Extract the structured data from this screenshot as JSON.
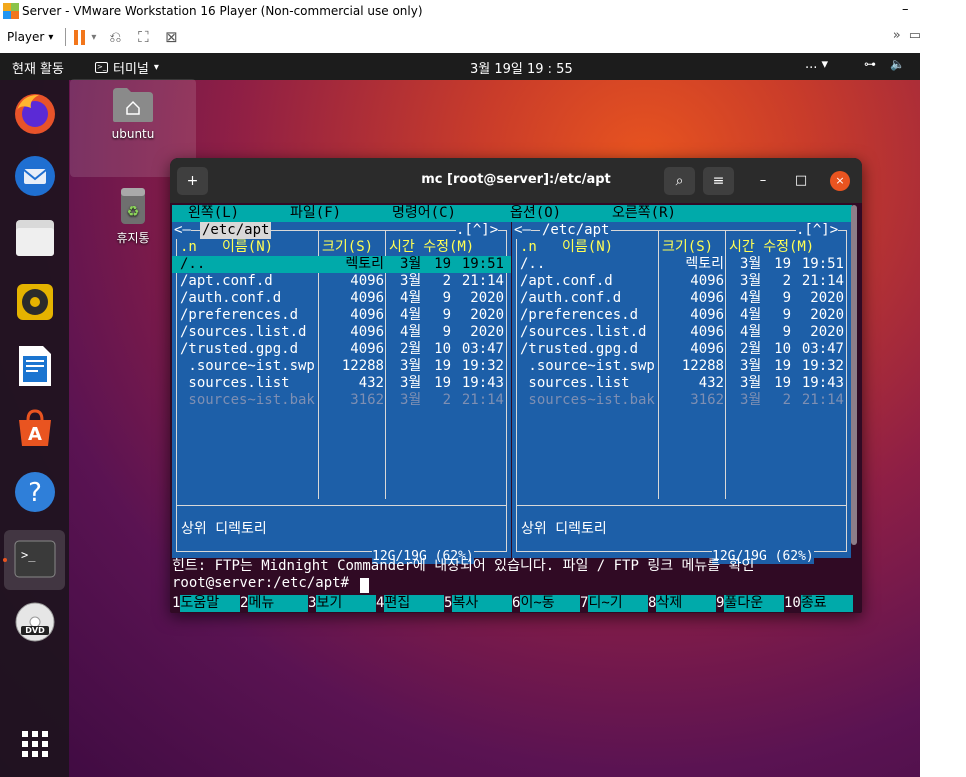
{
  "vm": {
    "title": "Server - VMware Workstation 16 Player (Non-commercial use only)",
    "minimize": "–",
    "player_menu": "Player",
    "player_caret": "▾",
    "toolbar_caret": "▾"
  },
  "guest": {
    "topbar": {
      "activities": "현재 활동",
      "app_name": "터미널",
      "app_caret": "▾",
      "clock": "3월 19일  19 : 55",
      "overflow": "... ▾"
    },
    "desktop": {
      "home_label": "ubuntu",
      "trash_label": "휴지통"
    }
  },
  "terminal": {
    "title": "mc [root@server]:/etc/apt",
    "new_tab_icon": "+",
    "search_icon": "⌕",
    "menu_icon": "≡",
    "minimize": "–",
    "maximize": "□",
    "close": "×"
  },
  "mc": {
    "menubar": [
      "왼쪽(L)",
      "파일(F)",
      "명령어(C)",
      "옵션(O)",
      "오른쪽(R)"
    ],
    "panel_corner_left": "<–",
    "panel_corner_right": ".[^]>",
    "left_panel": {
      "path": "/etc/apt",
      "header": {
        "n": ".n",
        "name": "이름(N)",
        "size": "크기(S)",
        "mtime": "시간 수정(M)"
      },
      "files": [
        {
          "name": "/..",
          "size": "렉토리",
          "month": "3월",
          "day": "19",
          "time": "19:51",
          "selected": true
        },
        {
          "name": "/apt.conf.d",
          "size": "4096",
          "month": "3월",
          "day": "2",
          "time": "21:14"
        },
        {
          "name": "/auth.conf.d",
          "size": "4096",
          "month": "4월",
          "day": "9",
          "time": "2020"
        },
        {
          "name": "/preferences.d",
          "size": "4096",
          "month": "4월",
          "day": "9",
          "time": "2020"
        },
        {
          "name": "/sources.list.d",
          "size": "4096",
          "month": "4월",
          "day": "9",
          "time": "2020"
        },
        {
          "name": "/trusted.gpg.d",
          "size": "4096",
          "month": "2월",
          "day": "10",
          "time": "03:47"
        },
        {
          "name": " .source~ist.swp",
          "size": "12288",
          "month": "3월",
          "day": "19",
          "time": "19:32"
        },
        {
          "name": " sources.list",
          "size": "432",
          "month": "3월",
          "day": "19",
          "time": "19:43"
        },
        {
          "name": " sources~ist.bak",
          "size": "3162",
          "month": "3월",
          "day": "2",
          "time": "21:14",
          "dim": true
        }
      ],
      "status": "상위 디렉토리",
      "disk": "12G/19G (62%)"
    },
    "right_panel": {
      "path": "/etc/apt",
      "header": {
        "n": ".n",
        "name": "이름(N)",
        "size": "크기(S)",
        "mtime": "시간 수정(M)"
      },
      "files": [
        {
          "name": "/..",
          "size": "렉토리",
          "month": "3월",
          "day": "19",
          "time": "19:51"
        },
        {
          "name": "/apt.conf.d",
          "size": "4096",
          "month": "3월",
          "day": "2",
          "time": "21:14"
        },
        {
          "name": "/auth.conf.d",
          "size": "4096",
          "month": "4월",
          "day": "9",
          "time": "2020"
        },
        {
          "name": "/preferences.d",
          "size": "4096",
          "month": "4월",
          "day": "9",
          "time": "2020"
        },
        {
          "name": "/sources.list.d",
          "size": "4096",
          "month": "4월",
          "day": "9",
          "time": "2020"
        },
        {
          "name": "/trusted.gpg.d",
          "size": "4096",
          "month": "2월",
          "day": "10",
          "time": "03:47"
        },
        {
          "name": " .source~ist.swp",
          "size": "12288",
          "month": "3월",
          "day": "19",
          "time": "19:32"
        },
        {
          "name": " sources.list",
          "size": "432",
          "month": "3월",
          "day": "19",
          "time": "19:43"
        },
        {
          "name": " sources~ist.bak",
          "size": "3162",
          "month": "3월",
          "day": "2",
          "time": "21:14",
          "dim": true
        }
      ],
      "status": "상위 디렉토리",
      "disk": "12G/19G (62%)"
    },
    "hint": "힌트: FTP는 Midnight Commander에 내장되어 있습니다. 파일 / FTP 링크 메뉴를 확인",
    "prompt": "root@server:/etc/apt#",
    "fkeys": [
      {
        "num": "1",
        "label": "도움말"
      },
      {
        "num": "2",
        "label": "메뉴"
      },
      {
        "num": "3",
        "label": "보기"
      },
      {
        "num": "4",
        "label": "편집"
      },
      {
        "num": "5",
        "label": "복사"
      },
      {
        "num": "6",
        "label": "이~동"
      },
      {
        "num": "7",
        "label": "디~기"
      },
      {
        "num": "8",
        "label": "삭제"
      },
      {
        "num": "9",
        "label": "풀다운"
      },
      {
        "num": "10",
        "label": "종료"
      }
    ]
  }
}
